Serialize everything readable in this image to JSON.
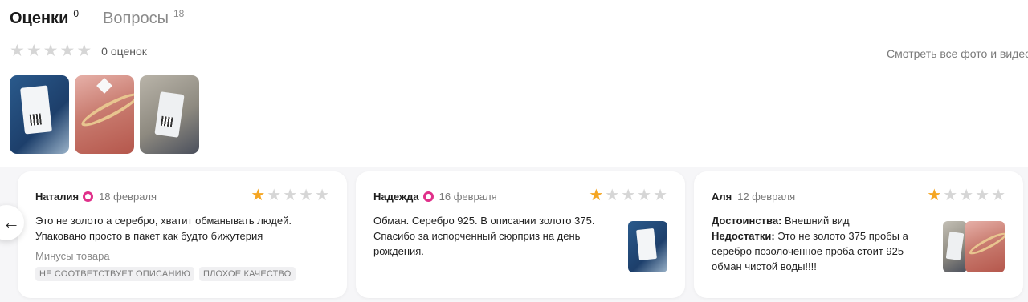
{
  "tabs": [
    {
      "label": "Оценки",
      "count": "0",
      "active": true
    },
    {
      "label": "Вопросы",
      "count": "18",
      "active": false
    }
  ],
  "summary": {
    "stars_filled": 0,
    "stars_total": 5,
    "count_text": "0 оценок"
  },
  "see_all_text": "Смотреть все фото и видео",
  "thumbnails": [
    {
      "icon": "photo-tag-blue"
    },
    {
      "icon": "photo-ring-pink"
    },
    {
      "icon": "photo-tag-grey"
    }
  ],
  "nav": {
    "prev_icon": "arrow-left-icon",
    "prev_glyph": "←"
  },
  "colors": {
    "star_filled": "#f5a623",
    "star_empty": "#d6d6d6",
    "badge": "#e0308a",
    "carousel_bg": "#f6f6f8"
  },
  "reviews": [
    {
      "author": "Наталия",
      "date": "18 февраля",
      "rating": 1,
      "text_lines": [
        "Это не золото а серебро, хватит обманывать людей.",
        "Упаковано просто в пакет как будто бижутерия"
      ],
      "cons_label": "Минусы товара",
      "cons_tags": [
        "НЕ СООТВЕТСТВУЕТ ОПИСАНИЮ",
        "ПЛОХОЕ КАЧЕСТВО"
      ]
    },
    {
      "author": "Надежда",
      "date": "16 февраля",
      "rating": 1,
      "text_lines": [
        "Обман. Серебро 925. В описании золото 375.",
        "Спасибо за испорченный сюрприз на день",
        "рождения."
      ]
    },
    {
      "author": "Аля",
      "date": "12 февраля",
      "rating": 1,
      "pros_label": "Достоинства:",
      "pros_text": "Внешний вид",
      "cons_label": "Недостатки:",
      "cons_text_lines": [
        "Это не золото 375 пробы а",
        "серебро позолоченное проба стоит 925",
        "обман чистой воды!!!!"
      ]
    }
  ]
}
